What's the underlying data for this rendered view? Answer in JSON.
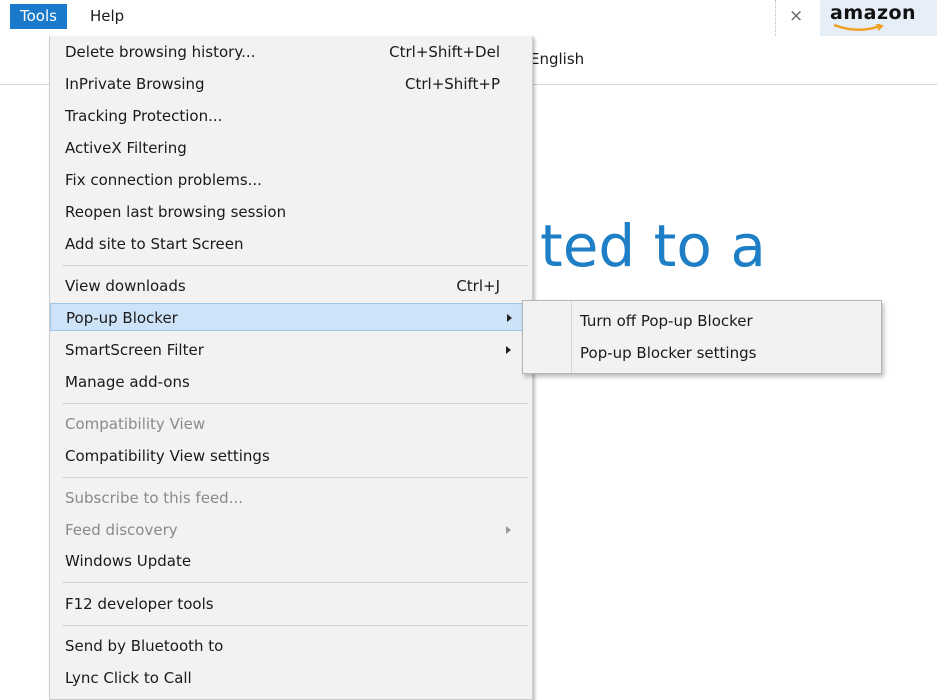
{
  "menubar": {
    "tools_label": "Tools",
    "help_label": "Help"
  },
  "tabs": {
    "close_glyph": "×",
    "amazon_logo": "amazon"
  },
  "page": {
    "toolbar_text": "English",
    "heading_text": "ted to a"
  },
  "tools_menu": {
    "delete_history": {
      "label": "Delete browsing history...",
      "shortcut": "Ctrl+Shift+Del"
    },
    "inprivate": {
      "label": "InPrivate Browsing",
      "shortcut": "Ctrl+Shift+P"
    },
    "tracking_protection": {
      "label": "Tracking Protection..."
    },
    "activex_filtering": {
      "label": "ActiveX Filtering"
    },
    "fix_connection": {
      "label": "Fix connection problems..."
    },
    "reopen_session": {
      "label": "Reopen last browsing session"
    },
    "add_to_start": {
      "label": "Add site to Start Screen"
    },
    "view_downloads": {
      "label": "View downloads",
      "shortcut": "Ctrl+J"
    },
    "popup_blocker": {
      "label": "Pop-up Blocker"
    },
    "smartscreen": {
      "label": "SmartScreen Filter"
    },
    "manage_addons": {
      "label": "Manage add-ons"
    },
    "compat_view": {
      "label": "Compatibility View"
    },
    "compat_settings": {
      "label": "Compatibility View settings"
    },
    "subscribe_feed": {
      "label": "Subscribe to this feed..."
    },
    "feed_discovery": {
      "label": "Feed discovery"
    },
    "windows_update": {
      "label": "Windows Update"
    },
    "f12_tools": {
      "label": "F12 developer tools"
    },
    "send_bluetooth": {
      "label": "Send by Bluetooth to"
    },
    "lync_call": {
      "label": "Lync Click to Call"
    }
  },
  "popup_submenu": {
    "turn_off": {
      "label": "Turn off Pop-up Blocker"
    },
    "settings": {
      "label": "Pop-up Blocker settings"
    }
  },
  "colors": {
    "accent": "#1979ca",
    "highlight": "#cde3f7",
    "heading": "#1e7fc6"
  }
}
